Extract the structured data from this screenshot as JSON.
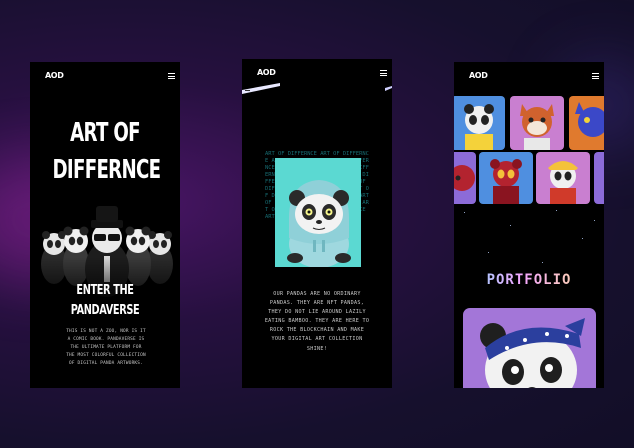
{
  "brand": {
    "logo": "AOD"
  },
  "screens": [
    {
      "hero_title_line1": "ART OF",
      "hero_title_line2": "DIFFERNCE",
      "cta_line1": "ENTER THE",
      "cta_line2": "PANDAVERSE",
      "description": "THIS IS NOT A ZOO, NOR IS IT A COMIC BOOK. PANDAVERSE IS THE ULTIMATE PLATFORM FOR THE MOST COLORFUL COLLECTION OF DIGITAL PANDA ARTWORKS."
    },
    {
      "pattern_text": "ART OF DIFFERNCE",
      "description": "OUR PANDAS ARE NO ORDINARY PANDAS. THEY ARE NFT PANDAS, THEY DO NOT LIE AROUND LAZILY EATING BAMBOO. THEY ARE HERE TO ROCK THE BLOCKCHAIN AND MAKE YOUR DIGITAL ART COLLECTION SHINE!"
    },
    {
      "section_title": "PORTFOLIO"
    }
  ],
  "colors": {
    "accent_cyan": "#5bd9d2",
    "card_purple": "#a376d8",
    "tile_blue": "#4f8fe0",
    "tile_pink": "#c97fd0",
    "tile_purple": "#8c6bd8"
  },
  "icons": [
    "menu-icon",
    "logo-mark"
  ]
}
